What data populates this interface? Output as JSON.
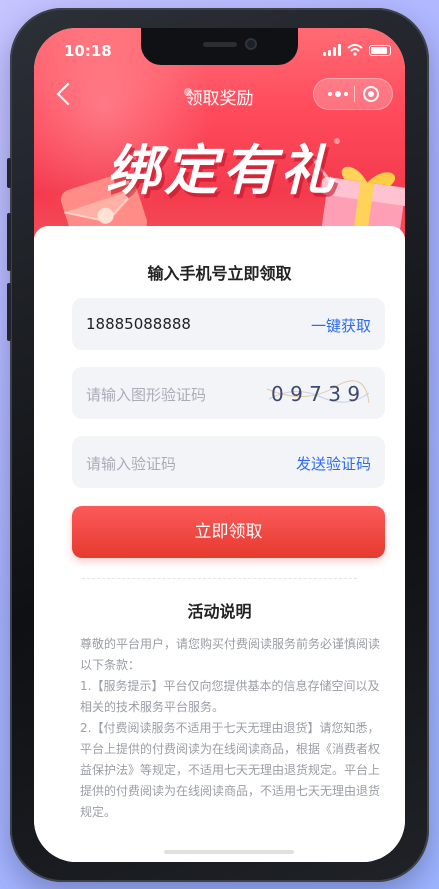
{
  "status_bar": {
    "time": "10:18"
  },
  "nav": {
    "title": "领取奖励"
  },
  "banner": {
    "title": "绑定有礼"
  },
  "form": {
    "heading": "输入手机号立即领取",
    "phone_value": "18885088888",
    "phone_action": "一键获取",
    "captcha_placeholder": "请输入图形验证码",
    "captcha_image_text": "0 9 7 3 9",
    "code_placeholder": "请输入验证码",
    "code_action": "发送验证码",
    "submit_label": "立即领取"
  },
  "rules": {
    "title": "活动说明",
    "paragraphs": [
      "尊敬的平台用户，请您购买付费阅读服务前务必谨慎阅读以下条款：",
      "1.【服务提示】平台仅向您提供基本的信息存储空间以及相关的技术服务平台服务。",
      "2.【付费阅读服务不适用于七天无理由退货】请您知悉，平台上提供的付费阅读为在线阅读商品，根据《消费者权益保护法》等规定，不适用七天无理由退货规定。平台上提供的付费阅读为在线阅读商品，不适用七天无理由退货规定。"
    ]
  },
  "colors": {
    "accent": "#f43a4d",
    "link": "#2c6bf5",
    "button_start": "#fb5a5a",
    "button_end": "#e63a2e"
  }
}
